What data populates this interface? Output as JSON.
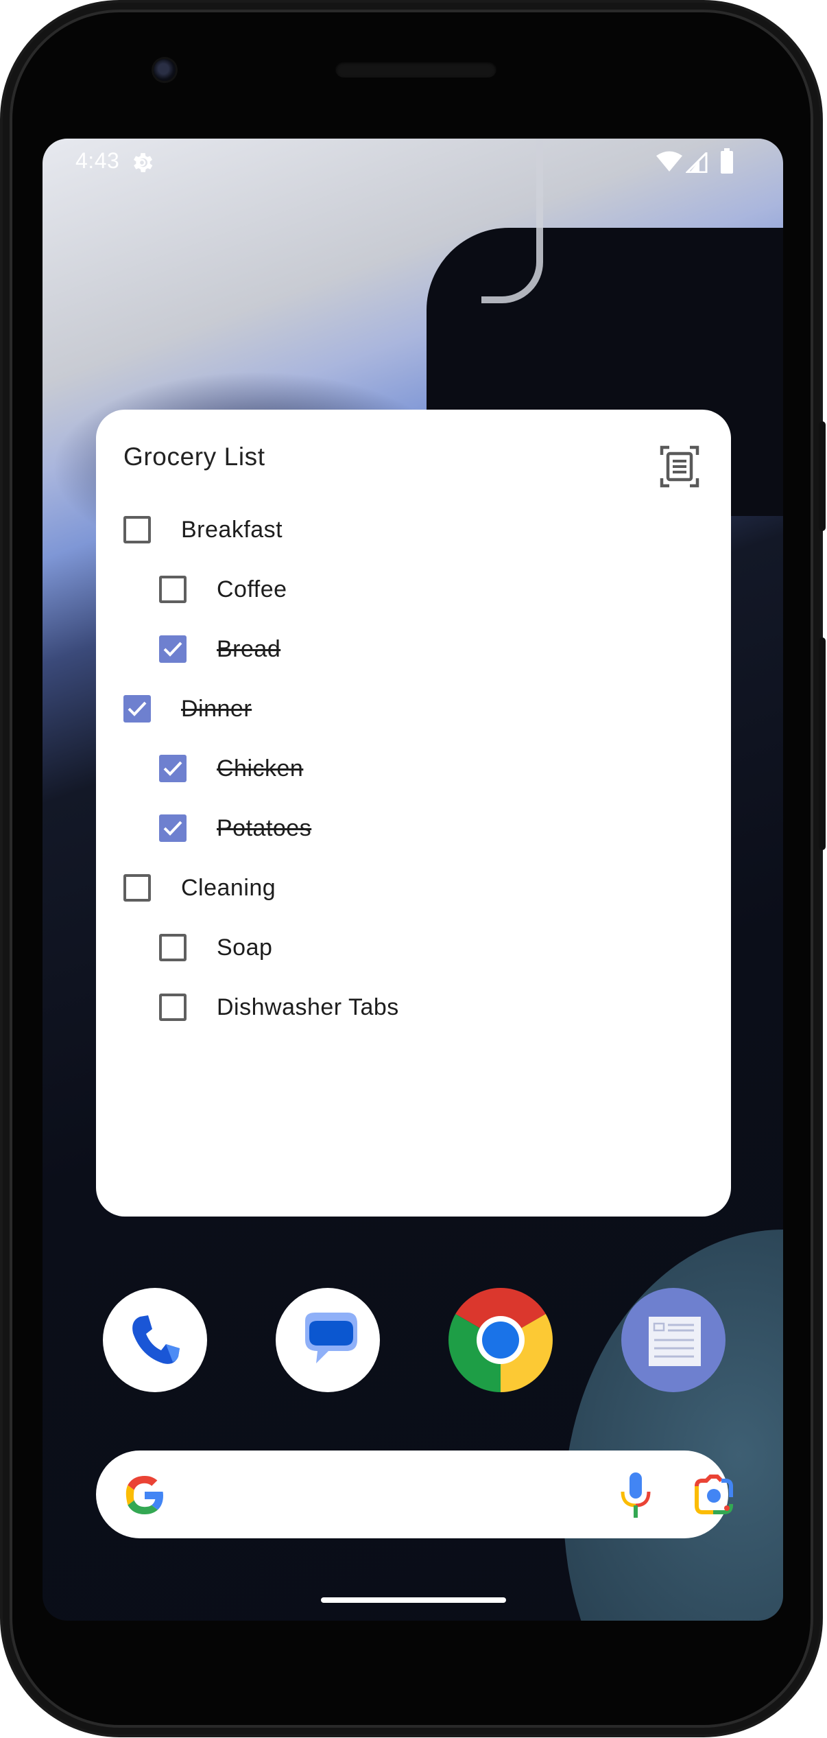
{
  "status_bar": {
    "time": "4:43",
    "icons": [
      "settings-gear-icon",
      "wifi-icon",
      "cellular-signal-icon",
      "battery-icon"
    ]
  },
  "widget": {
    "title": "Grocery List",
    "action_icon": "document-scan-icon",
    "accent_color": "#6e80cf",
    "items": [
      {
        "label": "Breakfast",
        "checked": false,
        "indent": 0
      },
      {
        "label": "Coffee",
        "checked": false,
        "indent": 1
      },
      {
        "label": "Bread",
        "checked": true,
        "indent": 1
      },
      {
        "label": "Dinner",
        "checked": true,
        "indent": 0
      },
      {
        "label": "Chicken",
        "checked": true,
        "indent": 1
      },
      {
        "label": "Potatoes",
        "checked": true,
        "indent": 1
      },
      {
        "label": "Cleaning",
        "checked": false,
        "indent": 0
      },
      {
        "label": "Soap",
        "checked": false,
        "indent": 1
      },
      {
        "label": "Dishwasher Tabs",
        "checked": false,
        "indent": 1
      }
    ]
  },
  "dock": {
    "apps": [
      {
        "name": "phone-app-icon"
      },
      {
        "name": "messages-app-icon"
      },
      {
        "name": "chrome-app-icon"
      },
      {
        "name": "notes-app-icon"
      }
    ]
  },
  "search_bar": {
    "icons": [
      "google-g-icon",
      "microphone-icon",
      "google-lens-icon"
    ]
  }
}
